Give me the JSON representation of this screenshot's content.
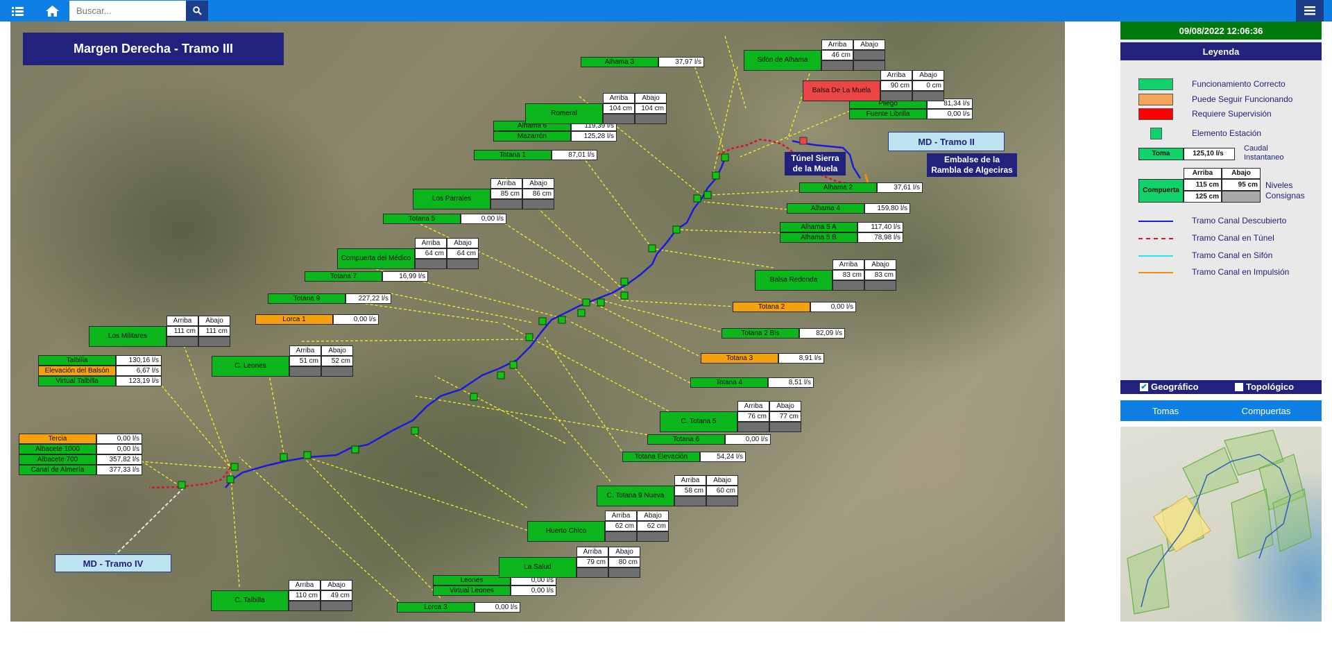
{
  "topbar": {
    "search_placeholder": "Buscar..."
  },
  "map": {
    "title": "Margen Derecha - Tramo III",
    "tramo_ii": "MD - Tramo II",
    "tramo_iv": "MD - Tramo IV",
    "tunel_label": "Túnel Sierra de la Muela",
    "embalse_label": "Embalse de la Rambla de Algeciras",
    "tomas": [
      {
        "name": "Alhama 3",
        "value": "37,97 l/s"
      },
      {
        "name": "Pliego",
        "value": "81,34 l/s"
      },
      {
        "name": "Fuente Librilla",
        "value": "0,00 l/s"
      },
      {
        "name": "Alhama 6",
        "value": "119,39 l/s"
      },
      {
        "name": "Mazarrón",
        "value": "125,28 l/s"
      },
      {
        "name": "Totana 1",
        "value": "87,01 l/s"
      },
      {
        "name": "Alhama 2",
        "value": "37,61 l/s"
      },
      {
        "name": "Alhama 4",
        "value": "159,80 l/s"
      },
      {
        "name": "Totana 5",
        "value": "0,00 l/s"
      },
      {
        "name": "Alhama 5 A",
        "value": "117,40 l/s"
      },
      {
        "name": "Alhama 5 B",
        "value": "78,98 l/s"
      },
      {
        "name": "Totana 7",
        "value": "16,99 l/s"
      },
      {
        "name": "Totana 9",
        "value": "227,22 l/s"
      },
      {
        "name": "Totana 2",
        "value": "0,00 l/s"
      },
      {
        "name": "Lorca 1",
        "value": "0,00 l/s"
      },
      {
        "name": "Totana 2 Bis",
        "value": "82,09 l/s"
      },
      {
        "name": "Talbilla",
        "value": "130,16 l/s"
      },
      {
        "name": "Elevación del Balsón",
        "value": "6,67 l/s"
      },
      {
        "name": "Virtual Talbilla",
        "value": "123,19 l/s"
      },
      {
        "name": "Totana 3",
        "value": "8,91 l/s"
      },
      {
        "name": "Totana 4",
        "value": "8,51 l/s"
      },
      {
        "name": "Tercia",
        "value": "0,00 l/s"
      },
      {
        "name": "Albacete 1000",
        "value": "0,00 l/s"
      },
      {
        "name": "Albacete 700",
        "value": "357,82 l/s"
      },
      {
        "name": "Canal de Almería",
        "value": "377,33 l/s"
      },
      {
        "name": "Totana 6",
        "value": "0,00 l/s"
      },
      {
        "name": "Totana Elevación",
        "value": "54,24 l/s"
      },
      {
        "name": "Leones",
        "value": "0,00 l/s"
      },
      {
        "name": "Virtual Leones",
        "value": "0,00 l/s"
      },
      {
        "name": "Lorca 3",
        "value": "0,00 l/s"
      }
    ],
    "compuertas": [
      {
        "name": "Sifón de Alhama",
        "arriba": "46 cm",
        "abajo": ""
      },
      {
        "name": "Balsa De La Muela",
        "arriba": "90 cm",
        "abajo": "0 cm"
      },
      {
        "name": "Romeral",
        "arriba": "104 cm",
        "abajo": "104 cm"
      },
      {
        "name": "Los Parrales",
        "arriba": "85 cm",
        "abajo": "86 cm"
      },
      {
        "name": "Compuerta del Médico",
        "arriba": "64 cm",
        "abajo": "64 cm"
      },
      {
        "name": "Balsa Redonda",
        "arriba": "83 cm",
        "abajo": "83 cm"
      },
      {
        "name": "Los Militares",
        "arriba": "111 cm",
        "abajo": "111 cm"
      },
      {
        "name": "C. Leones",
        "arriba": "51 cm",
        "abajo": "52 cm"
      },
      {
        "name": "C. Totana 5",
        "arriba": "76 cm",
        "abajo": "77 cm"
      },
      {
        "name": "C. Totana 9 Nueva",
        "arriba": "58 cm",
        "abajo": "60 cm"
      },
      {
        "name": "Huerto Chico",
        "arriba": "62 cm",
        "abajo": "62 cm"
      },
      {
        "name": "La Salud",
        "arriba": "79 cm",
        "abajo": "80 cm"
      },
      {
        "name": "C. Talbilla",
        "arriba": "110 cm",
        "abajo": "49 cm"
      }
    ],
    "hdr_arriba": "Arriba",
    "hdr_abajo": "Abajo"
  },
  "panel": {
    "datetime": "09/08/2022 12:06:36",
    "legend_title": "Leyenda",
    "status": [
      {
        "label": "Funcionamiento Correcto",
        "color": "#0fd36a"
      },
      {
        "label": "Puede Seguir Funcionando",
        "color": "#f7a55a"
      },
      {
        "label": "Requiere Supervisión",
        "color": "#ff0000"
      }
    ],
    "elemento_estacion": "Elemento Estación",
    "toma_name": "Toma",
    "toma_value": "125,10  l/s",
    "caudal": "Caudal Instantaneo",
    "comp_name": "Compuerta",
    "comp_arriba_hdr": "Arriba",
    "comp_abajo_hdr": "Abajo",
    "comp_arriba1": "115  cm",
    "comp_abajo1": "95  cm",
    "comp_arriba2": "125  cm",
    "niveles": "Niveles Consignas",
    "lines": [
      {
        "label": "Tramo Canal Descubierto",
        "color": "#1a1adc"
      },
      {
        "label": "Tramo Canal en Túnel",
        "color": "#d8142a"
      },
      {
        "label": "Tramo Canal en Sifón",
        "color": "#22e5f0"
      },
      {
        "label": "Tramo Canal en Impulsión",
        "color": "#f58a12"
      }
    ],
    "geografico": "Geográfico",
    "topologico": "Topológico",
    "tab_tomas": "Tomas",
    "tab_compuertas": "Compuertas"
  }
}
